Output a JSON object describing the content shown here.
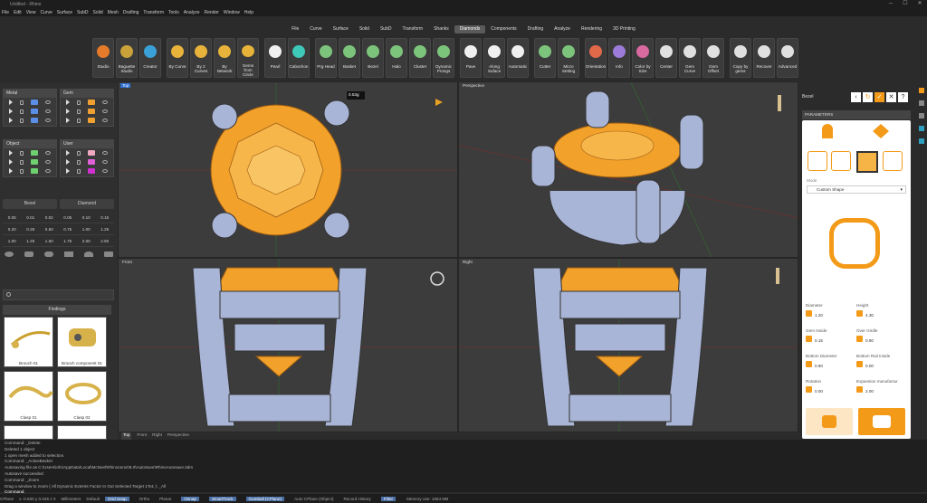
{
  "titlebar": {
    "title": "Untitled - Rhino",
    "min": "─",
    "max": "☐",
    "close": "✕"
  },
  "menu": [
    "File",
    "Edit",
    "View",
    "Curve",
    "Surface",
    "SubD",
    "Solid",
    "Mesh",
    "Drafting",
    "Transform",
    "Tools",
    "Analyze",
    "Render",
    "Window",
    "Help"
  ],
  "tabs": [
    "File",
    "Curve",
    "Surface",
    "Solid",
    "SubD",
    "Transform",
    "Shanks",
    "Diamonds",
    "Components",
    "Drafting",
    "Analyze",
    "Rendering",
    "3D Printing"
  ],
  "active_tab": "Diamonds",
  "tools": [
    {
      "label": "Studio",
      "color": "#e57b2a"
    },
    {
      "label": "Baguette Studio",
      "color": "#c9a23a"
    },
    {
      "label": "Creator",
      "color": "#3aa0d8"
    },
    {
      "label": "By Curve",
      "color": "#e8b33a"
    },
    {
      "label": "By 2 Curves",
      "color": "#e8b33a"
    },
    {
      "label": "By Network",
      "color": "#e8b33a"
    },
    {
      "label": "Gems from Circle",
      "color": "#e8b33a"
    },
    {
      "label": "Pearl",
      "color": "#f0f0f0"
    },
    {
      "label": "Cabochon",
      "color": "#3ec8b8"
    },
    {
      "label": "Prg Head",
      "color": "#7cc47c"
    },
    {
      "label": "Basket",
      "color": "#7cc47c"
    },
    {
      "label": "Bezel",
      "color": "#7cc47c"
    },
    {
      "label": "Halo",
      "color": "#7cc47c"
    },
    {
      "label": "Cluster",
      "color": "#7cc47c"
    },
    {
      "label": "Dynamic Prongs",
      "color": "#7cc47c"
    },
    {
      "label": "Pave",
      "color": "#f0f0f0"
    },
    {
      "label": "Along Suface",
      "color": "#f0f0f0"
    },
    {
      "label": "Automatic",
      "color": "#f0f0f0"
    },
    {
      "label": "Cutter",
      "color": "#7cc47c"
    },
    {
      "label": "Micro Setting",
      "color": "#7cc47c"
    },
    {
      "label": "Orientation",
      "color": "#e0694a"
    },
    {
      "label": "Info",
      "color": "#9c7cd8"
    },
    {
      "label": "Color by Size",
      "color": "#d86aa0"
    },
    {
      "label": "Center",
      "color": "#e0e0e0"
    },
    {
      "label": "Gem Curve",
      "color": "#e0e0e0"
    },
    {
      "label": "Gem Offset",
      "color": "#e0e0e0"
    },
    {
      "label": "Copy by gems",
      "color": "#e0e0e0"
    },
    {
      "label": "Recover",
      "color": "#e0e0e0"
    },
    {
      "label": "Advanced",
      "color": "#e0e0e0"
    }
  ],
  "materials": {
    "metal": {
      "title": "Metal",
      "colors": [
        "#5b8ee6",
        "#5b8ee6",
        "#5b8ee6"
      ]
    },
    "gem": {
      "title": "Gem",
      "colors": [
        "#f0a030",
        "#f0a030",
        "#f0a030"
      ]
    },
    "object": {
      "title": "Object",
      "colors": [
        "#6ed06e",
        "#6ed06e",
        "#6ed06e"
      ]
    },
    "user": {
      "title": "User",
      "colors": [
        "#f0a8c0",
        "#e060d8",
        "#d030d0"
      ]
    }
  },
  "setting": {
    "opt1": "Bezel",
    "opt2": "Diamond"
  },
  "sizes": [
    "0.05",
    "0.01",
    "0.02",
    "0.05",
    "0.10",
    "0.15",
    "0.20",
    "0.25",
    "0.50",
    "0.75",
    "1.00",
    "1.25",
    "1.00",
    "1.25",
    "1.50",
    "1.75",
    "2.00",
    "2.50"
  ],
  "findings": {
    "title": "Findings",
    "items": [
      "Brooch 01",
      "Brooch component 01",
      "Clasp 01",
      "Clasp 02"
    ]
  },
  "viewports": {
    "top": "Top",
    "perspective": "Perspective",
    "front": "Front",
    "right": "Right",
    "weight": "0.53g"
  },
  "viewtabs": [
    "Top",
    "Front",
    "Right",
    "Perspective"
  ],
  "right": {
    "header": "Bezel",
    "section": "PARAMETERS",
    "mode_label": "Mode",
    "mode": "Custom Shape",
    "fields": [
      {
        "label": "Diameter",
        "value": "1.20"
      },
      {
        "label": "Height",
        "value": "4.30"
      },
      {
        "label": "Gem Inside",
        "value": "0.15"
      },
      {
        "label": "Over Girdle",
        "value": "0.90"
      },
      {
        "label": "Bottom Diameter",
        "value": "0.90"
      },
      {
        "label": "Bottom Rail Inside",
        "value": "0.00"
      },
      {
        "label": "Rotation",
        "value": "0.00"
      },
      {
        "label": "Expansion manufactur",
        "value": "2.00"
      }
    ]
  },
  "commands": [
    "Command: _Delete",
    "Deleted 1 object",
    "1 open mesh added to selection.",
    "Command: _ActiveBasket",
    "Autosaving file as C:\\Users\\info\\AppData\\Local\\McNeel\\Rhinoceros\\8.0\\AutoSave\\RhinoAutosave.3dm",
    "Autosave succeeded",
    "Command: _Zoom",
    "Drag a window to zoom ( All  Dynamic  Extents  Factor  In  Out  Selected  Target  1To1 ): _All",
    "Command:"
  ],
  "status": {
    "cplane": "CPlane",
    "coords": "x -0.500  y 0.045  z 0",
    "units": "Millimeters",
    "layer": "Default",
    "toggles": [
      "Grid Snap",
      "Ortho",
      "Planar",
      "Osnap",
      "SmartTrack",
      "Gumball (CPlane)",
      "Auto CPlane (Object)",
      "Record History",
      "Filter"
    ],
    "memory": "Memory use: 1064 MB"
  }
}
